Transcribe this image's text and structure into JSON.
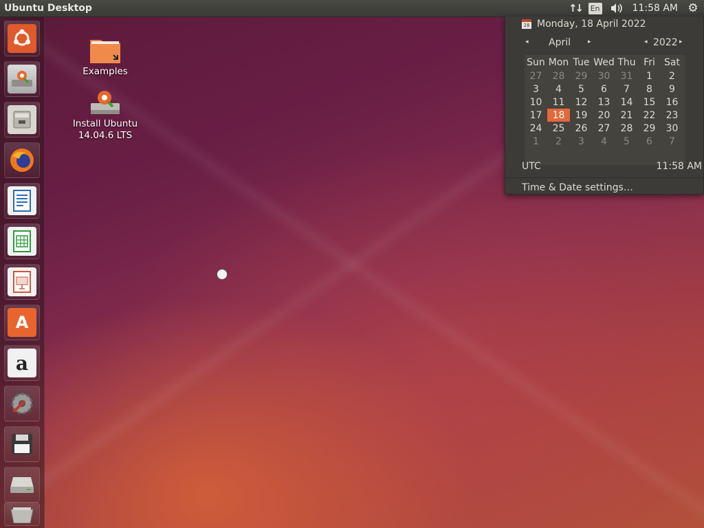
{
  "panel": {
    "title": "Ubuntu Desktop",
    "keyboard": "En",
    "clock": "11:58 AM"
  },
  "launcher": {
    "items": [
      {
        "name": "ubuntu-dash",
        "icon": "ubuntu-logo-icon",
        "color": "#e05a2b"
      },
      {
        "name": "install-ubuntu",
        "icon": "installer-icon",
        "color": "#c9c7c0"
      },
      {
        "name": "files",
        "icon": "file-cabinet-icon",
        "color": "#d9d6cf"
      },
      {
        "name": "firefox",
        "icon": "firefox-icon",
        "color": "#f07818"
      },
      {
        "name": "libreoffice-writer",
        "icon": "writer-doc-icon",
        "color": "#2a6bb5"
      },
      {
        "name": "libreoffice-calc",
        "icon": "calc-sheet-icon",
        "color": "#2e9b3e"
      },
      {
        "name": "libreoffice-impress",
        "icon": "impress-slide-icon",
        "color": "#d0563b"
      },
      {
        "name": "software-center",
        "icon": "shopping-bag-icon",
        "color": "#e8662d"
      },
      {
        "name": "amazon",
        "icon": "amazon-icon",
        "color": "#f1f1f1"
      },
      {
        "name": "system-settings",
        "icon": "wrench-icon",
        "color": "#9a9a9a"
      },
      {
        "name": "floppy",
        "icon": "floppy-icon",
        "color": "#3a3a3a"
      },
      {
        "name": "drive",
        "icon": "drive-icon",
        "color": "#c4c3bd"
      },
      {
        "name": "trash",
        "icon": "trash-icon",
        "color": "#bdbcb6"
      }
    ]
  },
  "desktop": {
    "icons": [
      {
        "label": "Examples",
        "icon": "folder-icon"
      },
      {
        "label": "Install Ubuntu\n14.04.6 LTS",
        "icon": "installer-icon"
      }
    ]
  },
  "calendar": {
    "date_header": "Monday, 18 April 2022",
    "month": "April",
    "year": "2022",
    "day_names": [
      "Sun",
      "Mon",
      "Tue",
      "Wed",
      "Thu",
      "Fri",
      "Sat"
    ],
    "weeks": [
      [
        "27",
        "28",
        "29",
        "30",
        "31",
        "1",
        "2"
      ],
      [
        "3",
        "4",
        "5",
        "6",
        "7",
        "8",
        "9"
      ],
      [
        "10",
        "11",
        "12",
        "13",
        "14",
        "15",
        "16"
      ],
      [
        "17",
        "18",
        "19",
        "20",
        "21",
        "22",
        "23"
      ],
      [
        "24",
        "25",
        "26",
        "27",
        "28",
        "29",
        "30"
      ],
      [
        "1",
        "2",
        "3",
        "4",
        "5",
        "6",
        "7"
      ]
    ],
    "today": "18",
    "timezone": "UTC",
    "timezone_time": "11:58 AM",
    "settings_label": "Time & Date settings…",
    "accent": "#e4683b"
  }
}
